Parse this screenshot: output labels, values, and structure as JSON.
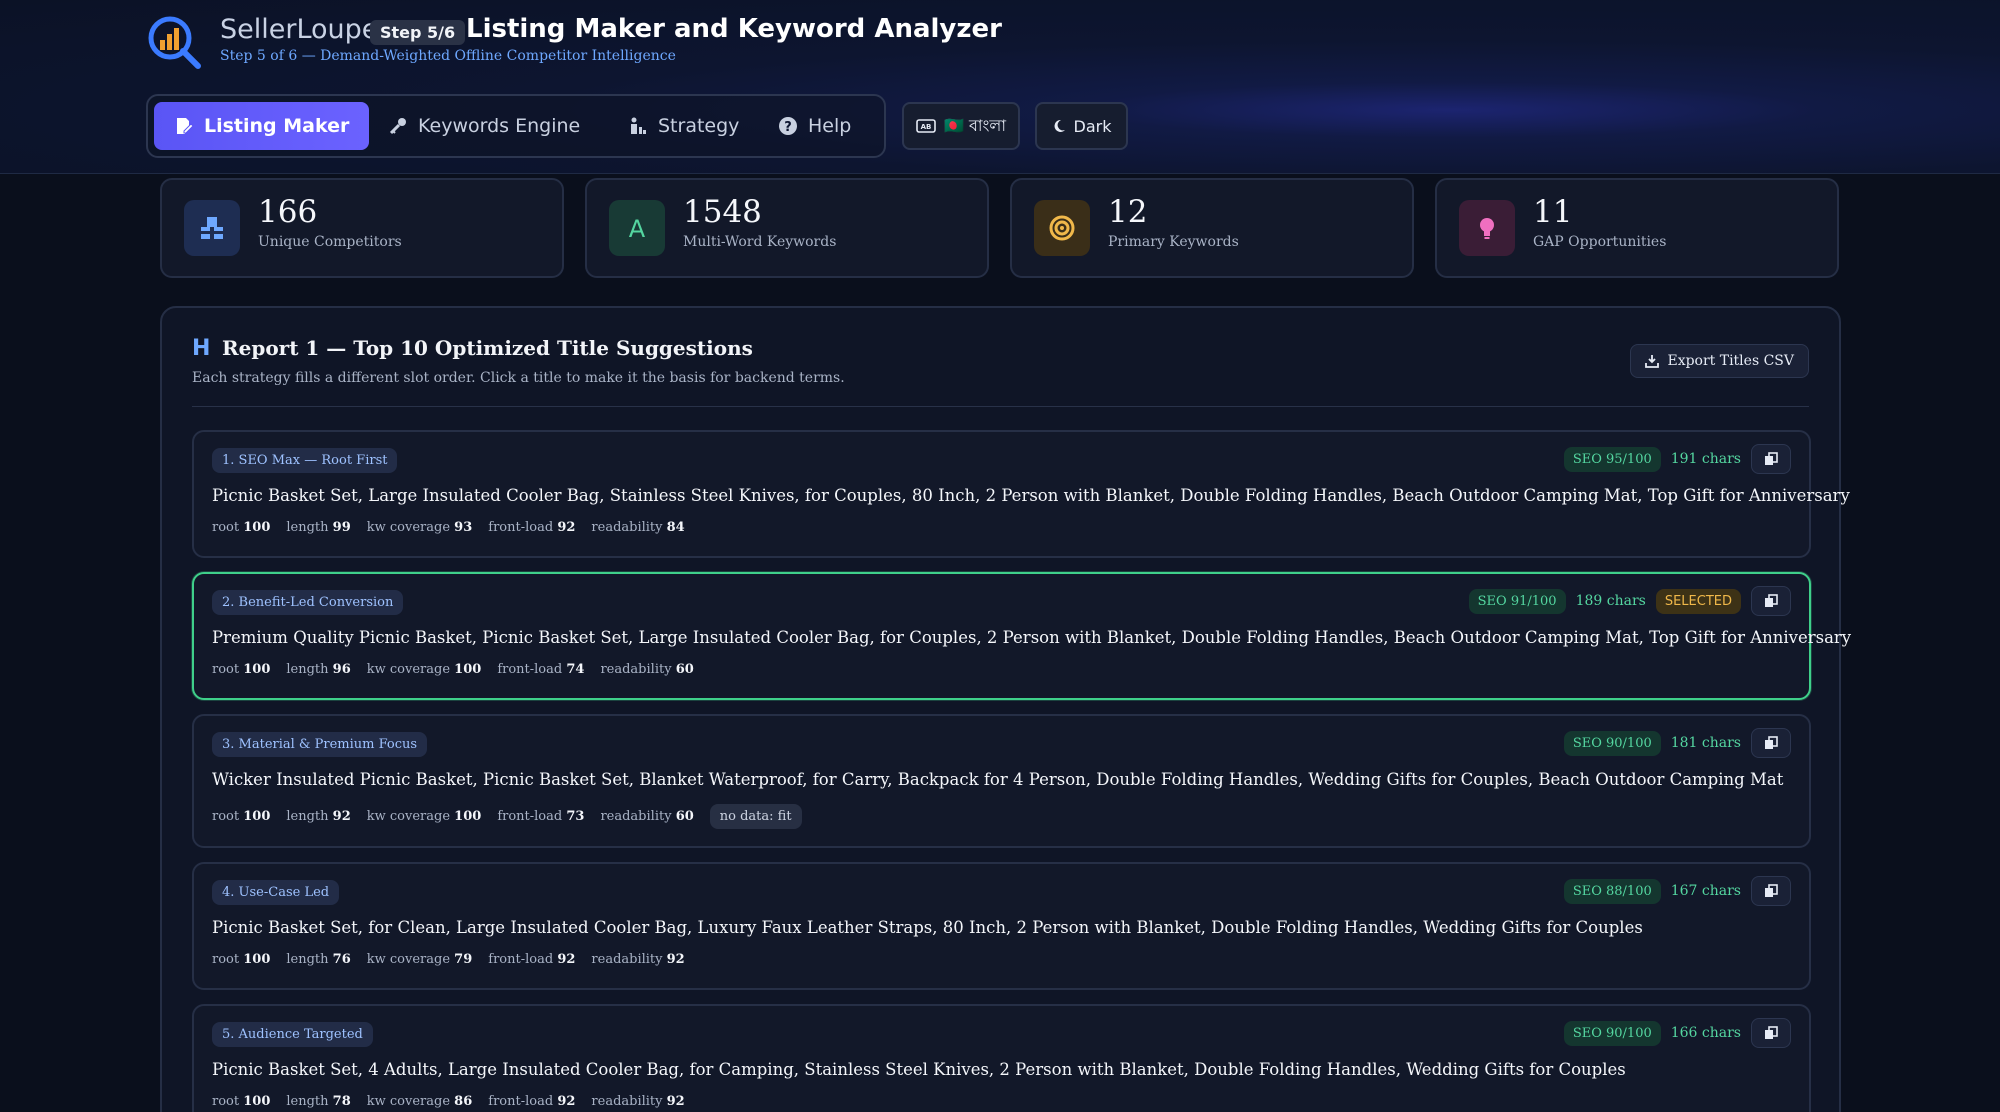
{
  "header": {
    "brand": "SellerLoupe",
    "step_badge": "Step 5/6",
    "title": "Listing Maker and Keyword Analyzer",
    "subtitle": "Step 5 of 6 — Demand-Weighted Offline Competitor Intelligence"
  },
  "tabs": [
    {
      "label": "Listing Maker",
      "icon": "edit-icon",
      "active": true
    },
    {
      "label": "Keywords Engine",
      "icon": "key-icon",
      "active": false
    },
    {
      "label": "Strategy",
      "icon": "strategy-icon",
      "active": false
    },
    {
      "label": "Help",
      "icon": "help-icon",
      "active": false
    }
  ],
  "language_button": "🇧🇩 বাংলা",
  "theme_button": "Dark",
  "stats": [
    {
      "value": "166",
      "label": "Unique Competitors",
      "icon": "competitors-icon",
      "color": "#6ea8ff"
    },
    {
      "value": "1548",
      "label": "Multi-Word Keywords",
      "icon": "letter-a-icon",
      "color": "#54d6a0"
    },
    {
      "value": "12",
      "label": "Primary Keywords",
      "icon": "target-icon",
      "color": "#f0b84a"
    },
    {
      "value": "11",
      "label": "GAP Opportunities",
      "icon": "lightbulb-icon",
      "color": "#f06fc0"
    }
  ],
  "report": {
    "heading_icon": "H",
    "title": "Report 1 — Top 10 Optimized Title Suggestions",
    "description": "Each strategy fills a different slot order. Click a title to make it the basis for backend terms.",
    "export_label": "Export Titles CSV",
    "metric_labels": {
      "root": "root",
      "length": "length",
      "kw": "kw coverage",
      "front": "front-load",
      "read": "readability"
    },
    "titles": [
      {
        "strategy": "1. SEO Max — Root First",
        "seo": "SEO 95/100",
        "chars": "191 chars",
        "selected": false,
        "text": "Picnic Basket Set, Large Insulated Cooler Bag, Stainless Steel Knives, for Couples, 80 Inch, 2 Person with Blanket, Double Folding Handles, Beach Outdoor Camping Mat, Top Gift for Anniversary",
        "root": "100",
        "length": "99",
        "kw": "93",
        "front": "92",
        "read": "84",
        "note": ""
      },
      {
        "strategy": "2. Benefit-Led Conversion",
        "seo": "SEO 91/100",
        "chars": "189 chars",
        "selected": true,
        "selected_label": "SELECTED",
        "text": "Premium Quality Picnic Basket, Picnic Basket Set, Large Insulated Cooler Bag, for Couples, 2 Person with Blanket, Double Folding Handles, Beach Outdoor Camping Mat, Top Gift for Anniversary",
        "root": "100",
        "length": "96",
        "kw": "100",
        "front": "74",
        "read": "60",
        "note": ""
      },
      {
        "strategy": "3. Material & Premium Focus",
        "seo": "SEO 90/100",
        "chars": "181 chars",
        "selected": false,
        "text": "Wicker Insulated Picnic Basket, Picnic Basket Set, Blanket Waterproof, for Carry, Backpack for 4 Person, Double Folding Handles, Wedding Gifts for Couples, Beach Outdoor Camping Mat",
        "root": "100",
        "length": "92",
        "kw": "100",
        "front": "73",
        "read": "60",
        "note": "no data: fit"
      },
      {
        "strategy": "4. Use-Case Led",
        "seo": "SEO 88/100",
        "chars": "167 chars",
        "selected": false,
        "text": "Picnic Basket Set, for Clean, Large Insulated Cooler Bag, Luxury Faux Leather Straps, 80 Inch, 2 Person with Blanket, Double Folding Handles, Wedding Gifts for Couples",
        "root": "100",
        "length": "76",
        "kw": "79",
        "front": "92",
        "read": "92",
        "note": ""
      },
      {
        "strategy": "5. Audience Targeted",
        "seo": "SEO 90/100",
        "chars": "166 chars",
        "selected": false,
        "text": "Picnic Basket Set, 4 Adults, Large Insulated Cooler Bag, for Camping, Stainless Steel Knives, 2 Person with Blanket, Double Folding Handles, Wedding Gifts for Couples",
        "root": "100",
        "length": "78",
        "kw": "86",
        "front": "92",
        "read": "92",
        "note": ""
      }
    ]
  }
}
